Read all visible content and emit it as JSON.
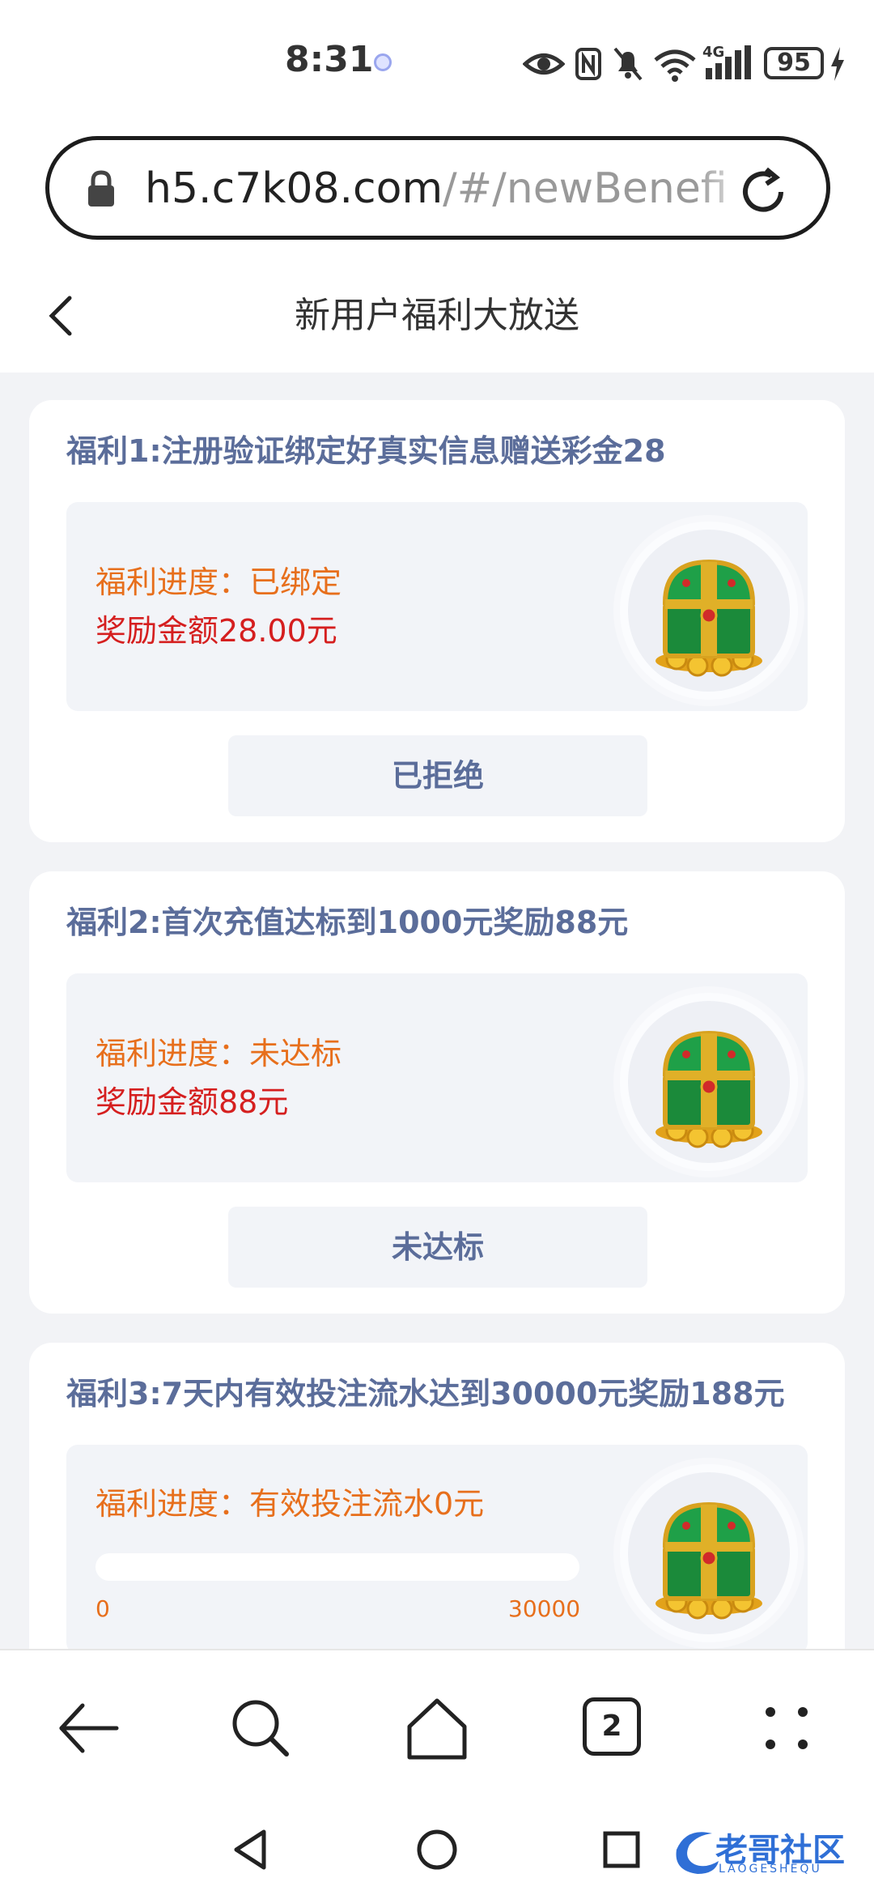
{
  "status_bar": {
    "time": "8:31",
    "network": "4G",
    "battery": "95",
    "icons": [
      "eye-icon",
      "nfc-icon",
      "mute-icon",
      "wifi-icon",
      "signal-icon",
      "battery-icon",
      "charging-icon"
    ]
  },
  "url_bar": {
    "host": "h5.c7k08.com",
    "path": "/#/newBenefi",
    "icons": [
      "lock-icon",
      "reload-icon"
    ]
  },
  "page": {
    "title": "新用户福利大放送"
  },
  "benefits": [
    {
      "title": "福利1:注册验证绑定好真实信息赠送彩金28",
      "progress": "福利进度：已绑定",
      "reward": "奖励金额28.00元",
      "button": "已拒绝"
    },
    {
      "title": "福利2:首次充值达标到1000元奖励88元",
      "progress": "福利进度：未达标",
      "reward": "奖励金额88元",
      "button": "未达标"
    },
    {
      "title": "福利3:7天内有效投注流水达到30000元奖励188元",
      "progress": "福利进度：有效投注流水0元",
      "bar_min": "0",
      "bar_max": "30000",
      "bar_fraction": 0
    }
  ],
  "browser_nav": {
    "tab_count": "2",
    "icons": [
      "back-arrow-icon",
      "search-icon",
      "home-icon",
      "tabs-icon",
      "more-icon"
    ]
  },
  "system_nav": {
    "icons": [
      "nav-back-icon",
      "nav-home-icon",
      "nav-recents-icon"
    ]
  },
  "watermark": {
    "text": "老哥社区",
    "sub": "LAOGESHEQU"
  },
  "colors": {
    "title_blue": "#5b6d9a",
    "progress_orange": "#e76f1c",
    "reward_red": "#d51f1f",
    "page_bg": "#f2f3f6"
  }
}
